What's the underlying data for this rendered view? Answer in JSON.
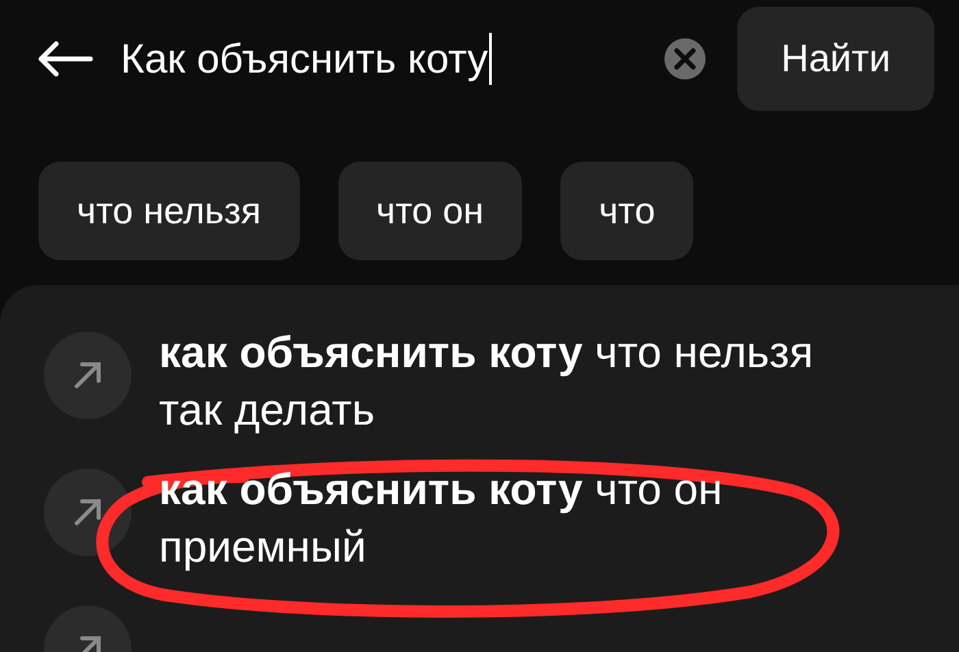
{
  "search": {
    "value": "Как объяснить коту",
    "button": "Найти"
  },
  "chips": [
    {
      "label": "что нельзя"
    },
    {
      "label": "что он"
    },
    {
      "label": "что"
    }
  ],
  "suggestions": [
    {
      "text": "**как объяснить коту** что нельзя так делать"
    },
    {
      "text": "**как объяснить коту** что он приемный"
    }
  ]
}
